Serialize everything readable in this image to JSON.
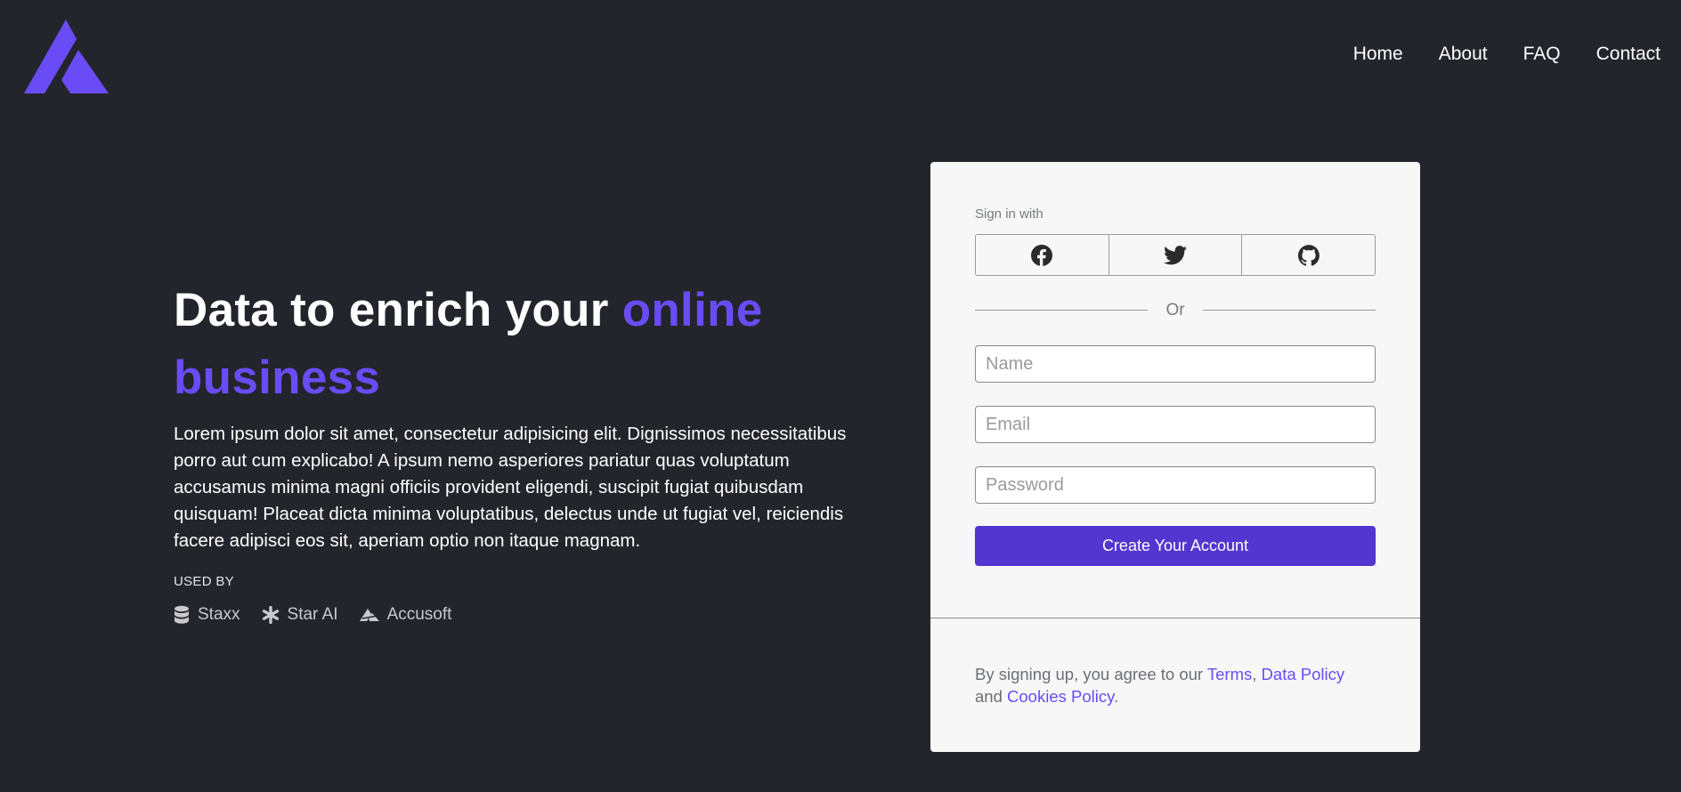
{
  "header": {
    "logo_icon": "brand-logo-icon",
    "nav": [
      {
        "label": "Home"
      },
      {
        "label": "About"
      },
      {
        "label": "FAQ"
      },
      {
        "label": "Contact"
      }
    ]
  },
  "hero": {
    "title_main": "Data to enrich your ",
    "title_accent": "online business",
    "description": "Lorem ipsum dolor sit amet, consectetur adipisicing elit. Dignissimos necessitatibus porro aut cum explicabo! A ipsum nemo asperiores pariatur quas voluptatum accusamus minima magni officiis provident eligendi, suscipit fugiat quibusdam quisquam! Placeat dicta minima voluptatibus, delectus unde ut fugiat vel, reiciendis facere adipisci eos sit, aperiam optio non itaque magnam.",
    "used_by_label": "USED BY",
    "used_by": [
      {
        "name": "Staxx",
        "icon": "database-icon"
      },
      {
        "name": "Star AI",
        "icon": "asterisk-icon"
      },
      {
        "name": "Accusoft",
        "icon": "accusoft-icon"
      }
    ]
  },
  "signup": {
    "signin_label": "Sign in with",
    "social": [
      {
        "icon": "facebook-icon"
      },
      {
        "icon": "twitter-icon"
      },
      {
        "icon": "github-icon"
      }
    ],
    "divider_text": "Or",
    "name_placeholder": "Name",
    "email_placeholder": "Email",
    "password_placeholder": "Password",
    "submit_label": "Create Your Account",
    "terms_prefix": "By signing up, you agree to our ",
    "terms_link": "Terms",
    "terms_sep": ", ",
    "data_policy_link": "Data Policy",
    "terms_and": " and ",
    "cookies_link": "Cookies Policy",
    "terms_suffix": "."
  },
  "colors": {
    "background": "#23252c",
    "accent": "#6a4cf6",
    "button": "#5236cf",
    "card": "#f7f7f7"
  }
}
